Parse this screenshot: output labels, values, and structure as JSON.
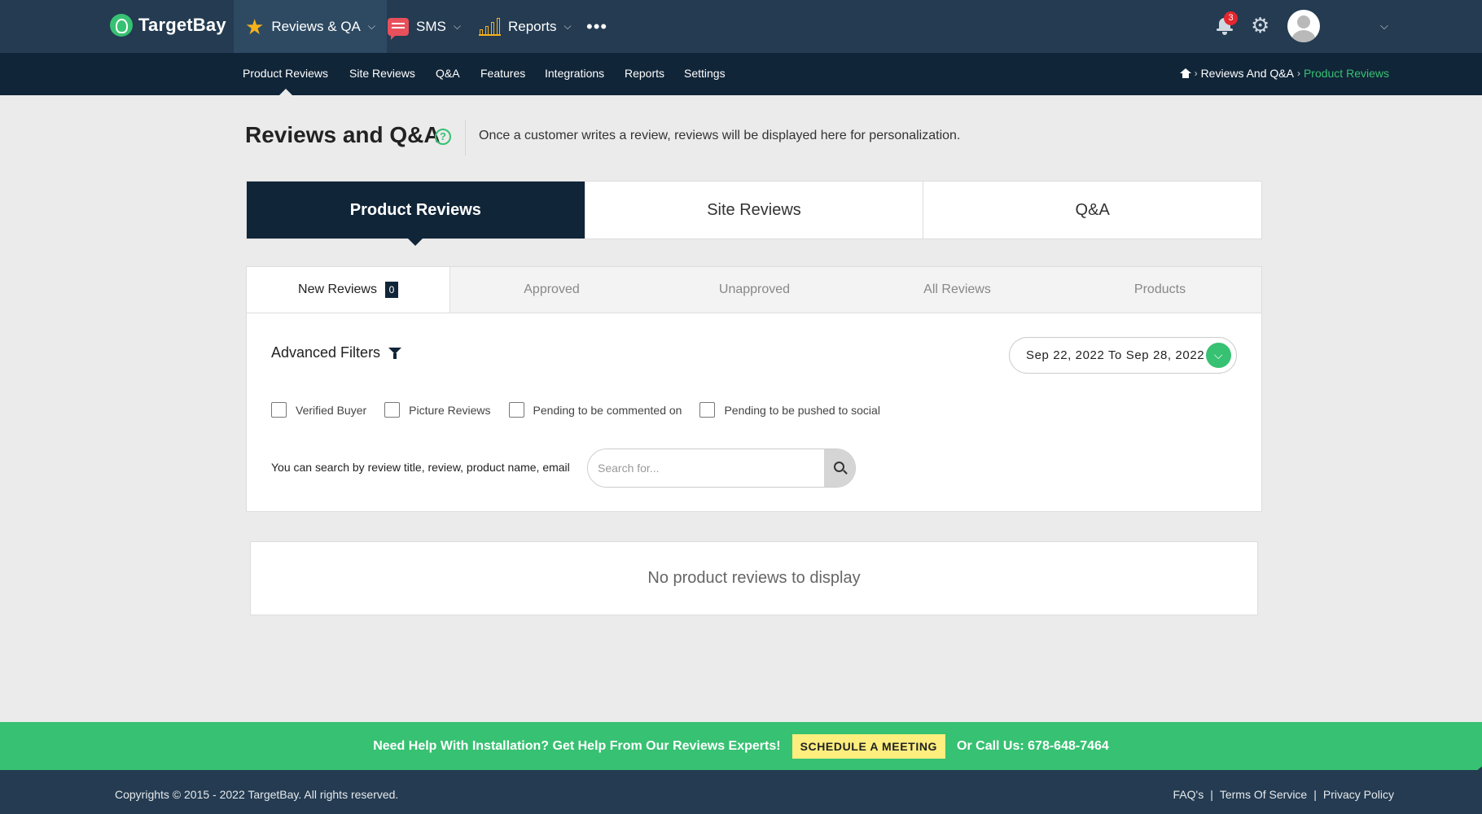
{
  "app": {
    "name": "TargetBay",
    "notification_count": "3"
  },
  "topnav": {
    "items": [
      {
        "label": "Reviews & QA",
        "icon": "star-icon"
      },
      {
        "label": "SMS",
        "icon": "chat-icon"
      },
      {
        "label": "Reports",
        "icon": "bar-chart-icon"
      }
    ],
    "more": "•••"
  },
  "subnav": {
    "items": [
      "Product Reviews",
      "Site Reviews",
      "Q&A",
      "Features",
      "Integrations",
      "Reports",
      "Settings"
    ]
  },
  "breadcrumb": {
    "items": [
      "Reviews And Q&A",
      "Product Reviews"
    ]
  },
  "header": {
    "title": "Reviews and Q&A",
    "description": "Once a customer writes a review, reviews will be displayed here for personalization."
  },
  "main_tabs": [
    "Product Reviews",
    "Site Reviews",
    "Q&A"
  ],
  "sub_tabs": {
    "items": [
      "New Reviews",
      "Approved",
      "Unapproved",
      "All Reviews",
      "Products"
    ],
    "new_count": "0"
  },
  "filters": {
    "title": "Advanced Filters",
    "date_range": "Sep 22, 2022 To Sep 28, 2022",
    "checkboxes": [
      "Verified Buyer",
      "Picture Reviews",
      "Pending to be commented on",
      "Pending to be pushed to social"
    ],
    "search_hint": "You can search by review title, review, product name, email",
    "search_placeholder": "Search for..."
  },
  "empty_state": "No product reviews to display",
  "help_strip": {
    "text": "Need Help With Installation? Get Help From Our Reviews Experts!",
    "button": "SCHEDULE A MEETING",
    "call": "Or Call Us: 678-648-7464"
  },
  "footer": {
    "copyright": "Copyrights © 2015 - 2022 TargetBay. All rights reserved.",
    "links": [
      "FAQ's",
      "Terms Of Service",
      "Privacy Policy"
    ]
  },
  "colors": {
    "accent": "#37c172",
    "nav_dark": "#243b51",
    "subnav_dark": "#112538",
    "badge_red": "#e3262e"
  }
}
